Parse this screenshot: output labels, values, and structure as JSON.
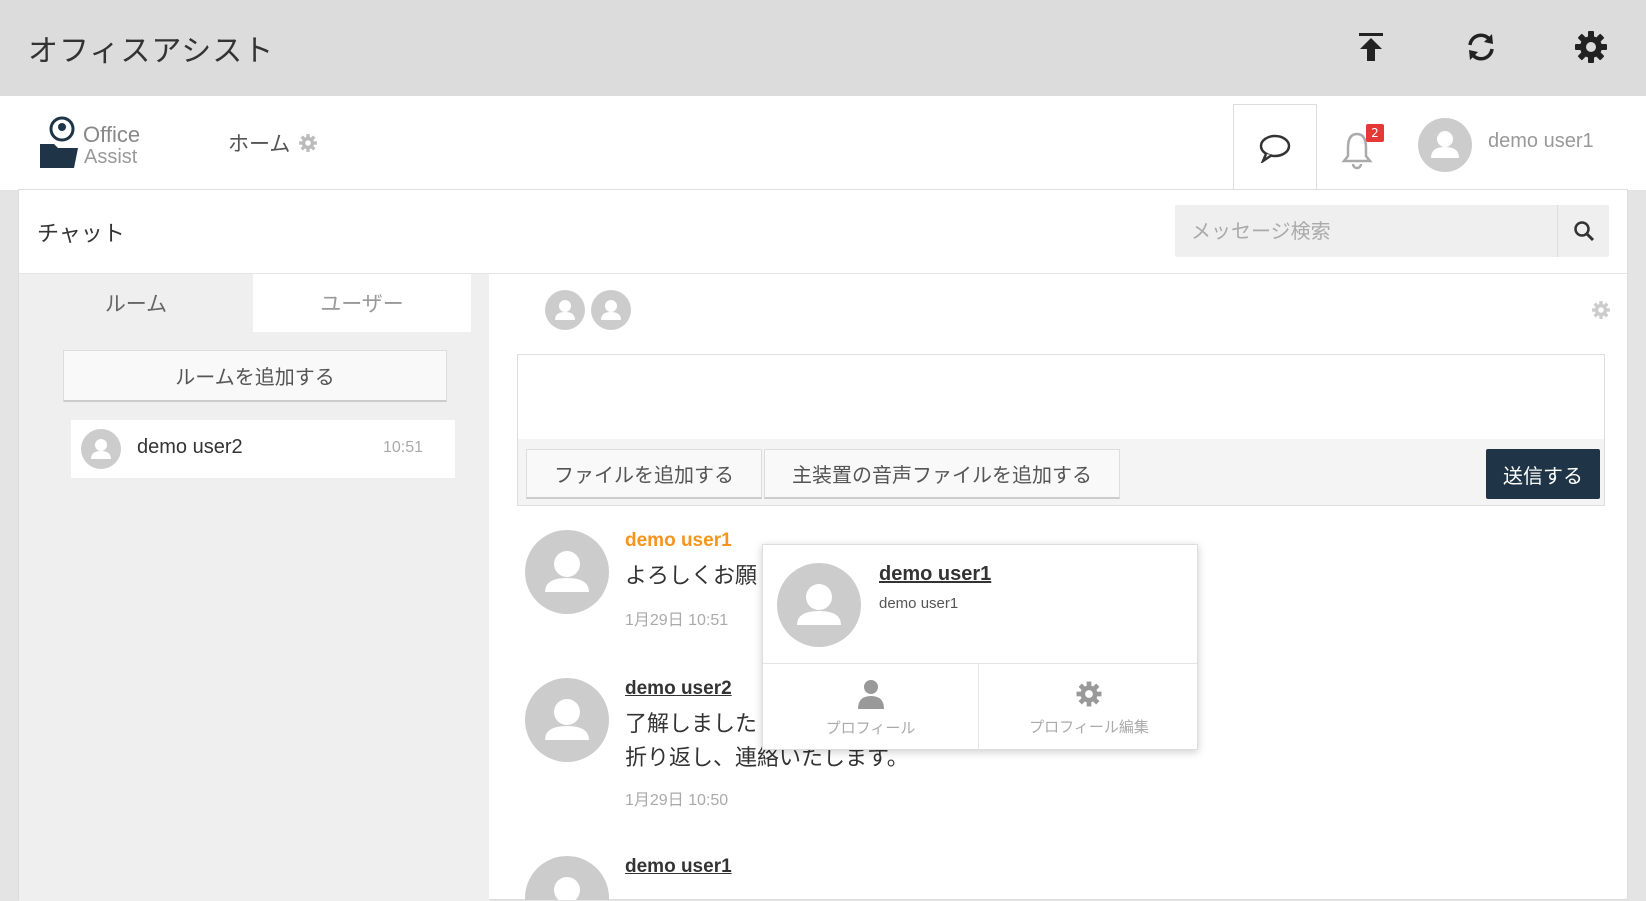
{
  "app": {
    "title": "オフィスアシスト"
  },
  "titlebar": {
    "icons": [
      "upload-icon",
      "sync-icon",
      "gear-icon"
    ]
  },
  "header": {
    "logo_office": "Office",
    "logo_assist": "Assist",
    "home_label": "ホーム",
    "notification_count": "2",
    "user_name": "demo user1"
  },
  "chat": {
    "title": "チャット",
    "search_placeholder": "メッセージ検索",
    "tabs": {
      "room": "ルーム",
      "user": "ユーザー"
    },
    "add_room_label": "ルームを追加する",
    "rooms": [
      {
        "name": "demo user2",
        "time": "10:51"
      }
    ],
    "composer": {
      "add_file_label": "ファイルを追加する",
      "add_audio_label": "主装置の音声ファイルを追加する",
      "send_label": "送信する"
    },
    "messages": [
      {
        "author": "demo user1",
        "text": "よろしくお願",
        "time": "1月29日 10:51"
      },
      {
        "author": "demo user2",
        "text_line1": "了解しました",
        "text_line2": "折り返し、連絡いたします。",
        "time": "1月29日 10:50"
      },
      {
        "author": "demo user1"
      }
    ],
    "popover": {
      "name": "demo user1",
      "sub": "demo user1",
      "profile_label": "プロフィール",
      "edit_label": "プロフィール編集"
    }
  },
  "colors": {
    "accent_orange": "#f7941d",
    "send_button": "#1f3547",
    "badge_red": "#e53935"
  }
}
